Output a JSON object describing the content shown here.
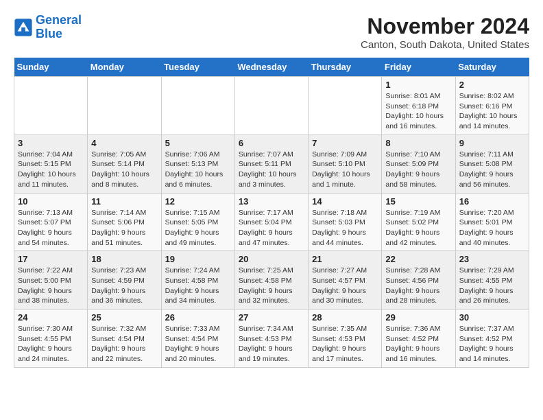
{
  "logo": {
    "line1": "General",
    "line2": "Blue"
  },
  "title": "November 2024",
  "subtitle": "Canton, South Dakota, United States",
  "days_of_week": [
    "Sunday",
    "Monday",
    "Tuesday",
    "Wednesday",
    "Thursday",
    "Friday",
    "Saturday"
  ],
  "weeks": [
    [
      {
        "day": "",
        "info": ""
      },
      {
        "day": "",
        "info": ""
      },
      {
        "day": "",
        "info": ""
      },
      {
        "day": "",
        "info": ""
      },
      {
        "day": "",
        "info": ""
      },
      {
        "day": "1",
        "info": "Sunrise: 8:01 AM\nSunset: 6:18 PM\nDaylight: 10 hours and 16 minutes."
      },
      {
        "day": "2",
        "info": "Sunrise: 8:02 AM\nSunset: 6:16 PM\nDaylight: 10 hours and 14 minutes."
      }
    ],
    [
      {
        "day": "3",
        "info": "Sunrise: 7:04 AM\nSunset: 5:15 PM\nDaylight: 10 hours and 11 minutes."
      },
      {
        "day": "4",
        "info": "Sunrise: 7:05 AM\nSunset: 5:14 PM\nDaylight: 10 hours and 8 minutes."
      },
      {
        "day": "5",
        "info": "Sunrise: 7:06 AM\nSunset: 5:13 PM\nDaylight: 10 hours and 6 minutes."
      },
      {
        "day": "6",
        "info": "Sunrise: 7:07 AM\nSunset: 5:11 PM\nDaylight: 10 hours and 3 minutes."
      },
      {
        "day": "7",
        "info": "Sunrise: 7:09 AM\nSunset: 5:10 PM\nDaylight: 10 hours and 1 minute."
      },
      {
        "day": "8",
        "info": "Sunrise: 7:10 AM\nSunset: 5:09 PM\nDaylight: 9 hours and 58 minutes."
      },
      {
        "day": "9",
        "info": "Sunrise: 7:11 AM\nSunset: 5:08 PM\nDaylight: 9 hours and 56 minutes."
      }
    ],
    [
      {
        "day": "10",
        "info": "Sunrise: 7:13 AM\nSunset: 5:07 PM\nDaylight: 9 hours and 54 minutes."
      },
      {
        "day": "11",
        "info": "Sunrise: 7:14 AM\nSunset: 5:06 PM\nDaylight: 9 hours and 51 minutes."
      },
      {
        "day": "12",
        "info": "Sunrise: 7:15 AM\nSunset: 5:05 PM\nDaylight: 9 hours and 49 minutes."
      },
      {
        "day": "13",
        "info": "Sunrise: 7:17 AM\nSunset: 5:04 PM\nDaylight: 9 hours and 47 minutes."
      },
      {
        "day": "14",
        "info": "Sunrise: 7:18 AM\nSunset: 5:03 PM\nDaylight: 9 hours and 44 minutes."
      },
      {
        "day": "15",
        "info": "Sunrise: 7:19 AM\nSunset: 5:02 PM\nDaylight: 9 hours and 42 minutes."
      },
      {
        "day": "16",
        "info": "Sunrise: 7:20 AM\nSunset: 5:01 PM\nDaylight: 9 hours and 40 minutes."
      }
    ],
    [
      {
        "day": "17",
        "info": "Sunrise: 7:22 AM\nSunset: 5:00 PM\nDaylight: 9 hours and 38 minutes."
      },
      {
        "day": "18",
        "info": "Sunrise: 7:23 AM\nSunset: 4:59 PM\nDaylight: 9 hours and 36 minutes."
      },
      {
        "day": "19",
        "info": "Sunrise: 7:24 AM\nSunset: 4:58 PM\nDaylight: 9 hours and 34 minutes."
      },
      {
        "day": "20",
        "info": "Sunrise: 7:25 AM\nSunset: 4:58 PM\nDaylight: 9 hours and 32 minutes."
      },
      {
        "day": "21",
        "info": "Sunrise: 7:27 AM\nSunset: 4:57 PM\nDaylight: 9 hours and 30 minutes."
      },
      {
        "day": "22",
        "info": "Sunrise: 7:28 AM\nSunset: 4:56 PM\nDaylight: 9 hours and 28 minutes."
      },
      {
        "day": "23",
        "info": "Sunrise: 7:29 AM\nSunset: 4:55 PM\nDaylight: 9 hours and 26 minutes."
      }
    ],
    [
      {
        "day": "24",
        "info": "Sunrise: 7:30 AM\nSunset: 4:55 PM\nDaylight: 9 hours and 24 minutes."
      },
      {
        "day": "25",
        "info": "Sunrise: 7:32 AM\nSunset: 4:54 PM\nDaylight: 9 hours and 22 minutes."
      },
      {
        "day": "26",
        "info": "Sunrise: 7:33 AM\nSunset: 4:54 PM\nDaylight: 9 hours and 20 minutes."
      },
      {
        "day": "27",
        "info": "Sunrise: 7:34 AM\nSunset: 4:53 PM\nDaylight: 9 hours and 19 minutes."
      },
      {
        "day": "28",
        "info": "Sunrise: 7:35 AM\nSunset: 4:53 PM\nDaylight: 9 hours and 17 minutes."
      },
      {
        "day": "29",
        "info": "Sunrise: 7:36 AM\nSunset: 4:52 PM\nDaylight: 9 hours and 16 minutes."
      },
      {
        "day": "30",
        "info": "Sunrise: 7:37 AM\nSunset: 4:52 PM\nDaylight: 9 hours and 14 minutes."
      }
    ]
  ]
}
